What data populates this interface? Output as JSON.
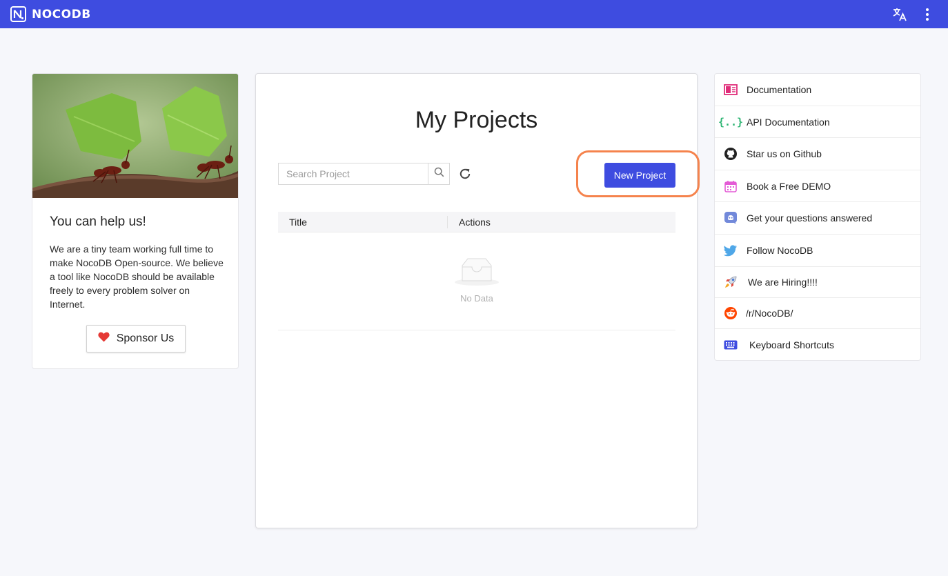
{
  "header": {
    "brand": "NOCODB",
    "icons": [
      "translate-icon",
      "kebab-menu-icon"
    ],
    "accent": "#3e4ce0"
  },
  "left": {
    "title": "You can help us!",
    "body": "We are a tiny team working full time to make NocoDB Open-source. We believe a tool like NocoDB should be available freely to every problem solver on Internet.",
    "sponsor_label": "Sponsor Us"
  },
  "main": {
    "title": "My Projects",
    "search_placeholder": "Search Project",
    "new_project_label": "New Project",
    "columns": [
      "Title",
      "Actions"
    ],
    "empty_text": "No Data"
  },
  "links": [
    {
      "label": "Documentation",
      "icon": "book-icon"
    },
    {
      "label": "API Documentation",
      "icon": "braces-icon"
    },
    {
      "label": "Star us on Github",
      "icon": "github-icon"
    },
    {
      "label": "Book a Free DEMO",
      "icon": "calendar-icon"
    },
    {
      "label": "Get your questions answered",
      "icon": "discord-icon"
    },
    {
      "label": "Follow NocoDB",
      "icon": "twitter-icon"
    },
    {
      "label": "We are Hiring!!!!",
      "icon": "rocket-icon"
    },
    {
      "label": "/r/NocoDB/",
      "icon": "reddit-icon"
    },
    {
      "label": "Keyboard Shortcuts",
      "icon": "keyboard-icon"
    }
  ]
}
